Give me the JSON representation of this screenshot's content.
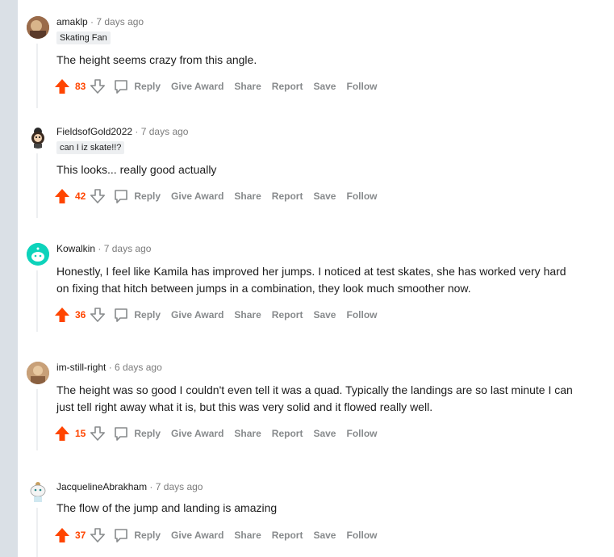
{
  "actions": {
    "reply": "Reply",
    "give_award": "Give Award",
    "share": "Share",
    "report": "Report",
    "save": "Save",
    "follow": "Follow"
  },
  "separator": "·",
  "comments": [
    {
      "author": "amaklp",
      "time": "7 days ago",
      "flair": "Skating Fan",
      "body": "The height seems crazy from this angle.",
      "score": "83"
    },
    {
      "author": "FieldsofGold2022",
      "time": "7 days ago",
      "flair": "can I iz skate!!?",
      "body": "This looks... really good actually",
      "score": "42"
    },
    {
      "author": "Kowalkin",
      "time": "7 days ago",
      "body": "Honestly, I feel like Kamila has improved her jumps. I noticed at test skates, she has worked very hard on fixing that hitch between jumps in a combination, they look much smoother now.",
      "score": "36"
    },
    {
      "author": "im-still-right",
      "time": "6 days ago",
      "body": "The height was so good I couldn't even tell it was a quad. Typically the landings are so last minute I can just tell right away what it is, but this was very solid and it flowed really well.",
      "score": "15"
    },
    {
      "author": "JacquelineAbrakham",
      "time": "7 days ago",
      "body": "The flow of the jump and landing is amazing",
      "score": "37"
    }
  ],
  "colors": {
    "upvote": "#ff4500",
    "muted": "#878a8c",
    "rail": "#dae0e6"
  },
  "icons": {
    "upvote": "upvote-arrow-icon",
    "downvote": "downvote-arrow-icon",
    "reply": "speech-bubble-icon"
  }
}
